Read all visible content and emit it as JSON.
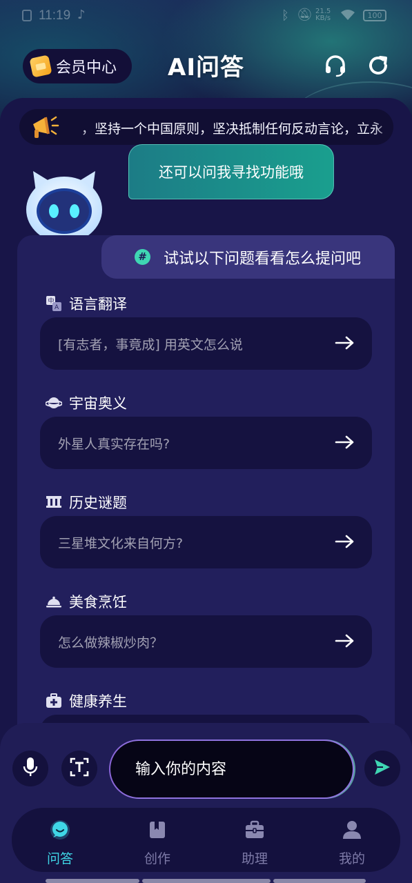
{
  "status_bar": {
    "time": "11:19",
    "net_speed_value": "21.5",
    "net_speed_unit": "KB/s",
    "battery": "100"
  },
  "header": {
    "vip_label": "会员中心",
    "title": "AI问答"
  },
  "notice": {
    "text": "，坚持一个中国原则，坚决抵制任何反动言论，立永"
  },
  "bot": {
    "greeting": "还可以问我寻找功能哦"
  },
  "suggestions": {
    "header": "试试以下问题看看怎么提问吧",
    "categories": [
      {
        "title": "语言翻译",
        "question": "[有志者，事竟成] 用英文怎么说",
        "icon": "translate-icon"
      },
      {
        "title": "宇宙奥义",
        "question": "外星人真实存在吗?",
        "icon": "planet-icon"
      },
      {
        "title": "历史谜题",
        "question": "三星堆文化来自何方?",
        "icon": "history-icon"
      },
      {
        "title": "美食烹饪",
        "question": "怎么做辣椒炒肉？",
        "icon": "food-cloche-icon"
      },
      {
        "title": "健康养生",
        "question": "",
        "icon": "medical-kit-icon"
      }
    ]
  },
  "input": {
    "placeholder": "输入你的内容"
  },
  "tabs": [
    {
      "label": "问答",
      "icon": "chat-icon",
      "active": true
    },
    {
      "label": "创作",
      "icon": "book-icon",
      "active": false
    },
    {
      "label": "助理",
      "icon": "briefcase-icon",
      "active": false
    },
    {
      "label": "我的",
      "icon": "user-icon",
      "active": false
    }
  ],
  "colors": {
    "accent_teal": "#3fd6b3",
    "active_tab": "#3fd6e6",
    "background": "#15123f"
  }
}
